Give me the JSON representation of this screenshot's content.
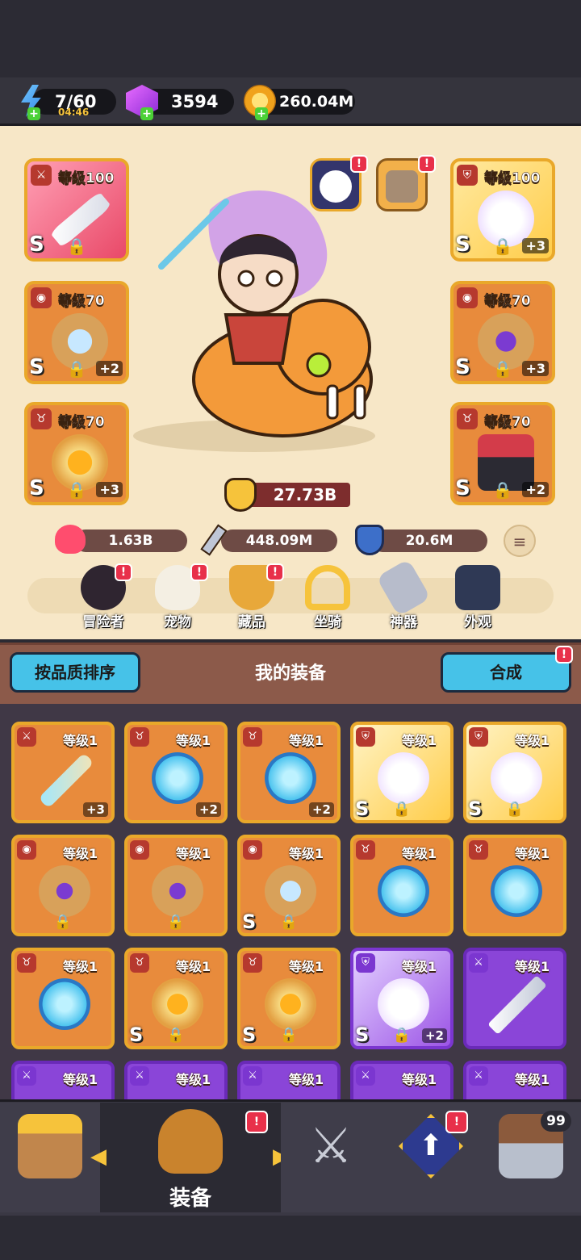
{
  "resources": {
    "energy": "7/60",
    "energy_timer": "04:46",
    "gems": "3594",
    "gold": "260.04M"
  },
  "hero": {
    "power": "27.73B",
    "hp": "1.63B",
    "attack": "448.09M",
    "defense": "20.6M"
  },
  "equipped": [
    {
      "side": "left",
      "level": "等级100",
      "tier": "S",
      "plus": "",
      "type_icon": "sword-icon"
    },
    {
      "side": "left",
      "level": "等级70",
      "tier": "S",
      "plus": "+2",
      "type_icon": "ring-icon"
    },
    {
      "side": "left",
      "level": "等级70",
      "tier": "S",
      "plus": "+3",
      "type_icon": "necklace-icon"
    },
    {
      "side": "right",
      "level": "等级100",
      "tier": "S",
      "plus": "+3",
      "type_icon": "armor-icon"
    },
    {
      "side": "right",
      "level": "等级70",
      "tier": "S",
      "plus": "+3",
      "type_icon": "ring-icon"
    },
    {
      "side": "right",
      "level": "等级70",
      "tier": "S",
      "plus": "+2",
      "type_icon": "necklace-icon"
    }
  ],
  "nav": [
    {
      "label": "冒险者",
      "badge": "!"
    },
    {
      "label": "宠物",
      "badge": "!"
    },
    {
      "label": "藏品",
      "badge": "!"
    },
    {
      "label": "坐骑",
      "badge": ""
    },
    {
      "label": "神器",
      "badge": ""
    },
    {
      "label": "外观",
      "badge": ""
    }
  ],
  "equipment_section": {
    "sort_button": "按品质排序",
    "title": "我的装备",
    "merge_button": "合成",
    "merge_badge": "!"
  },
  "inventory": [
    {
      "level": "等级1",
      "tier": "",
      "plus": "+3",
      "style": "orange",
      "art": "staff"
    },
    {
      "level": "等级1",
      "tier": "",
      "plus": "+2",
      "style": "orange",
      "art": "orb"
    },
    {
      "level": "等级1",
      "tier": "",
      "plus": "+2",
      "style": "orange",
      "art": "orb"
    },
    {
      "level": "等级1",
      "tier": "S",
      "plus": "",
      "style": "gold",
      "art": "cape"
    },
    {
      "level": "等级1",
      "tier": "S",
      "plus": "",
      "style": "gold",
      "art": "cape"
    },
    {
      "level": "等级1",
      "tier": "",
      "plus": "",
      "style": "orange",
      "art": "ring"
    },
    {
      "level": "等级1",
      "tier": "",
      "plus": "",
      "style": "orange",
      "art": "ring"
    },
    {
      "level": "等级1",
      "tier": "S",
      "plus": "",
      "style": "orange",
      "art": "crystal-ring"
    },
    {
      "level": "等级1",
      "tier": "",
      "plus": "",
      "style": "orange",
      "art": "orb"
    },
    {
      "level": "等级1",
      "tier": "",
      "plus": "",
      "style": "orange",
      "art": "orb"
    },
    {
      "level": "等级1",
      "tier": "",
      "plus": "",
      "style": "orange",
      "art": "orb"
    },
    {
      "level": "等级1",
      "tier": "S",
      "plus": "",
      "style": "orange",
      "art": "medal"
    },
    {
      "level": "等级1",
      "tier": "S",
      "plus": "",
      "style": "orange",
      "art": "medal"
    },
    {
      "level": "等级1",
      "tier": "S",
      "plus": "+2",
      "style": "purple",
      "art": "cape"
    },
    {
      "level": "等级1",
      "tier": "",
      "plus": "",
      "style": "purpleDark",
      "art": "sword"
    },
    {
      "level": "等级1",
      "tier": "",
      "plus": "",
      "style": "purpleDark",
      "art": "partial"
    },
    {
      "level": "等级1",
      "tier": "",
      "plus": "",
      "style": "purpleDark",
      "art": "partial"
    },
    {
      "level": "等级1",
      "tier": "",
      "plus": "",
      "style": "purpleDark",
      "art": "partial"
    },
    {
      "level": "等级1",
      "tier": "",
      "plus": "",
      "style": "purpleDark",
      "art": "partial"
    },
    {
      "level": "等级1",
      "tier": "",
      "plus": "",
      "style": "purpleDark",
      "art": "partial"
    }
  ],
  "bottom_nav": {
    "active_label": "装备",
    "chest_count": "99",
    "active_badge": "!",
    "upgrade_badge": "!"
  }
}
